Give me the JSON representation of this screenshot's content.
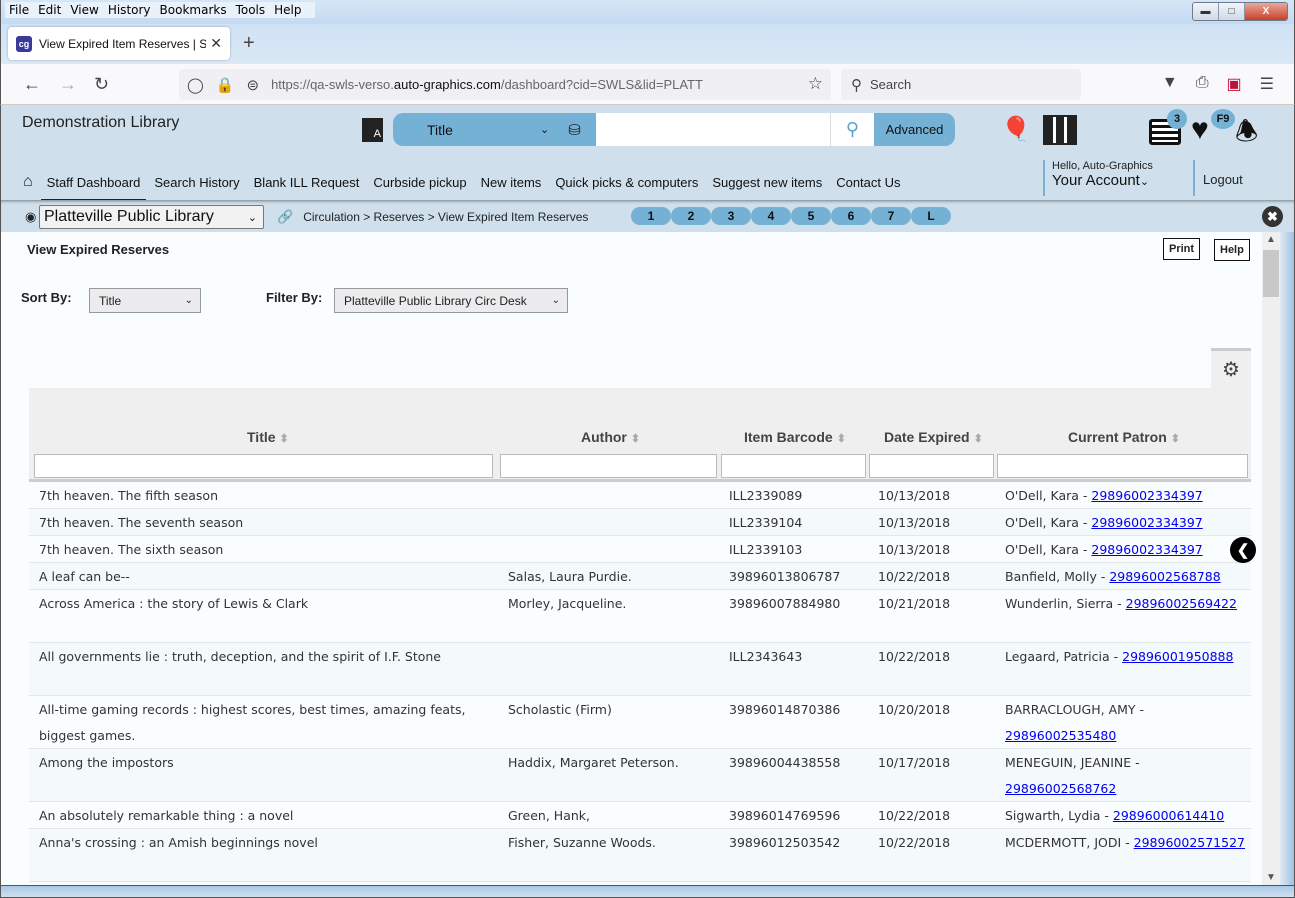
{
  "browser": {
    "menu": [
      "File",
      "Edit",
      "View",
      "History",
      "Bookmarks",
      "Tools",
      "Help"
    ],
    "tab_title": "View Expired Item Reserves | SWLS",
    "tab_favicon": "cg",
    "url_prefix": "https://qa-swls-verso.",
    "url_domain": "auto-graphics.com",
    "url_suffix": "/dashboard?cid=SWLS&lid=PLATT",
    "search_placeholder": "Search"
  },
  "header": {
    "library_name": "Demonstration Library",
    "search_field": "Title",
    "search_value": "",
    "advanced_label": "Advanced",
    "list_badge": "3",
    "favorites_badge": "F9"
  },
  "nav": {
    "items": [
      "Staff Dashboard",
      "Search History",
      "Blank ILL Request",
      "Curbside pickup",
      "New items",
      "Quick picks & computers",
      "Suggest new items",
      "Contact Us"
    ],
    "active": "Staff Dashboard",
    "hello": "Hello, Auto-Graphics",
    "account": "Your Account",
    "logout": "Logout"
  },
  "crumbbar": {
    "library": "Platteville Public Library",
    "breadcrumb": "Circulation > Reserves > View Expired Item Reserves",
    "pages": [
      "1",
      "2",
      "3",
      "4",
      "5",
      "6",
      "7",
      "L"
    ]
  },
  "page": {
    "title": "View Expired Reserves",
    "print_label": "Print",
    "help_label": "Help",
    "sort_label": "Sort By:",
    "sort_value": "Title",
    "filter_label": "Filter By:",
    "filter_value": "Platteville Public Library Circ Desk"
  },
  "table": {
    "columns": [
      "Title",
      "Author",
      "Item Barcode",
      "Date Expired",
      "Current Patron"
    ],
    "rows": [
      {
        "title": "7th heaven. The fifth season",
        "author": "",
        "barcode": "ILL2339089",
        "date": "10/13/2018",
        "patron": "O'Dell, Kara -",
        "patron_barcode": "29896002334397"
      },
      {
        "title": "7th heaven. The seventh season",
        "author": "",
        "barcode": "ILL2339104",
        "date": "10/13/2018",
        "patron": "O'Dell, Kara -",
        "patron_barcode": "29896002334397"
      },
      {
        "title": "7th heaven. The sixth season",
        "author": "",
        "barcode": "ILL2339103",
        "date": "10/13/2018",
        "patron": "O'Dell, Kara -",
        "patron_barcode": "29896002334397"
      },
      {
        "title": "A leaf can be--",
        "author": "Salas, Laura Purdie.",
        "barcode": "39896013806787",
        "date": "10/22/2018",
        "patron": "Banfield, Molly -",
        "patron_barcode": "29896002568788"
      },
      {
        "title": "Across America : the story of Lewis & Clark",
        "author": "Morley, Jacqueline.",
        "barcode": "39896007884980",
        "date": "10/21/2018",
        "patron": "Wunderlin, Sierra -",
        "patron_barcode": "29896002569422"
      },
      {
        "title": "All governments lie : truth, deception, and the spirit of I.F. Stone",
        "author": "",
        "barcode": "ILL2343643",
        "date": "10/22/2018",
        "patron": "Legaard, Patricia -",
        "patron_barcode": "29896001950888"
      },
      {
        "title": "All-time gaming records : highest scores, best times, amazing feats, biggest games.",
        "author": "Scholastic (Firm)",
        "barcode": "39896014870386",
        "date": "10/20/2018",
        "patron": "BARRACLOUGH, AMY -",
        "patron_barcode": "29896002535480"
      },
      {
        "title": "Among the impostors",
        "author": "Haddix, Margaret Peterson.",
        "barcode": "39896004438558",
        "date": "10/17/2018",
        "patron": "MENEGUIN, JEANINE -",
        "patron_barcode": "29896002568762"
      },
      {
        "title": "An absolutely remarkable thing : a novel",
        "author": "Green, Hank,",
        "barcode": "39896014769596",
        "date": "10/22/2018",
        "patron": "Sigwarth, Lydia -",
        "patron_barcode": "29896000614410"
      },
      {
        "title": "Anna's crossing : an Amish beginnings novel",
        "author": "Fisher, Suzanne Woods.",
        "barcode": "39896012503542",
        "date": "10/22/2018",
        "patron": "MCDERMOTT, JODI -",
        "patron_barcode": "29896002571527"
      }
    ]
  }
}
